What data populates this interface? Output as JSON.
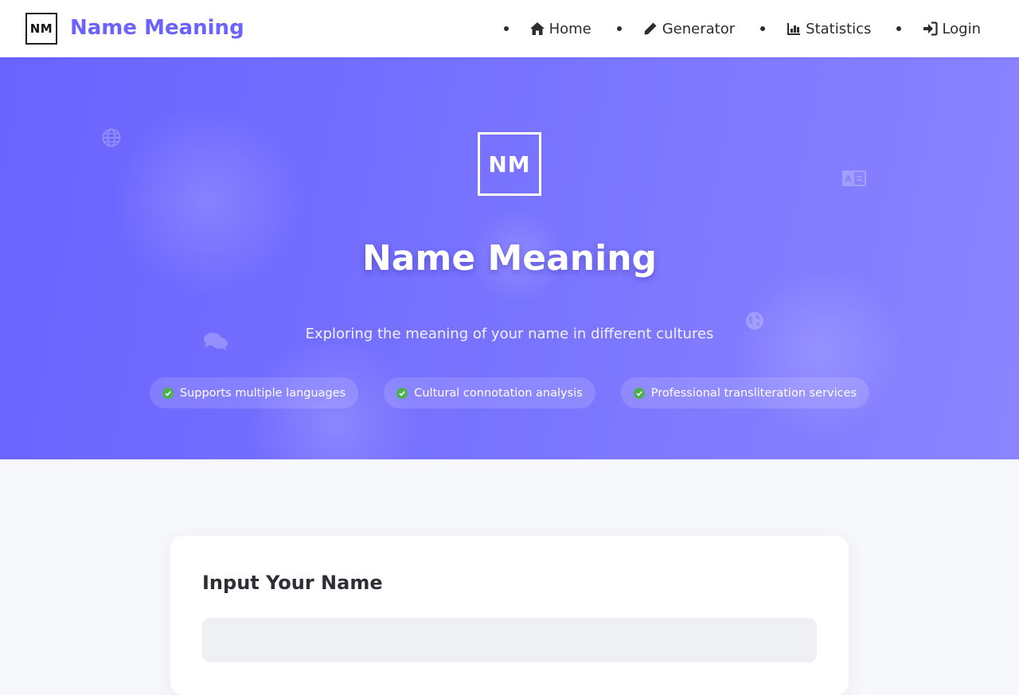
{
  "header": {
    "logo_text": "NM",
    "brand_name": "Name Meaning",
    "nav": [
      {
        "label": "Home",
        "icon": "home-icon"
      },
      {
        "label": "Generator",
        "icon": "pencil-icon"
      },
      {
        "label": "Statistics",
        "icon": "bar-chart-icon"
      },
      {
        "label": "Login",
        "icon": "sign-in-icon"
      }
    ]
  },
  "hero": {
    "logo_text": "NM",
    "title": "Name Meaning",
    "subtitle": "Exploring the meaning of your name in different cultures",
    "features": [
      "Supports multiple languages",
      "Cultural connotation analysis",
      "Professional transliteration services"
    ],
    "decor_icons": [
      "globe-icon",
      "translate-icon",
      "earth-icon",
      "comments-icon"
    ]
  },
  "card": {
    "title": "Input Your Name",
    "input_value": "",
    "input_placeholder": ""
  },
  "colors": {
    "accent": "#6c63ff",
    "hero_start": "#6a63ff",
    "hero_end": "#8a84ff",
    "check_green": "#4caf50",
    "text_dark": "#2d2d2d",
    "page_bg": "#f7f8fc"
  }
}
